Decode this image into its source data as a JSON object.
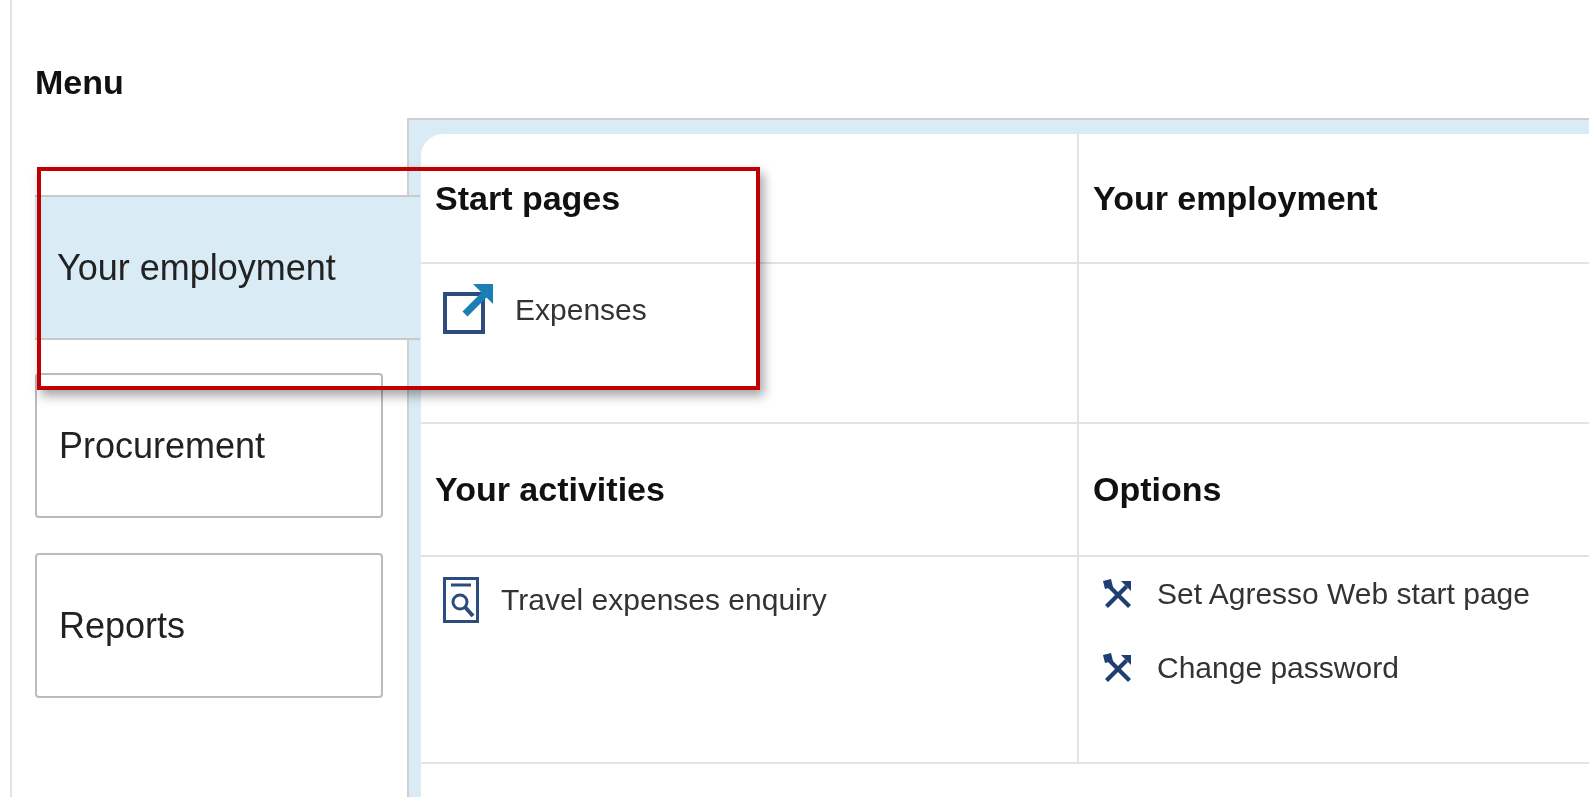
{
  "title": "Menu",
  "sidebar": {
    "items": [
      {
        "label": "Your employment",
        "selected": true
      },
      {
        "label": "Procurement",
        "selected": false
      },
      {
        "label": "Reports",
        "selected": false
      }
    ]
  },
  "panel": {
    "sections": [
      {
        "heading": "Start pages",
        "items": [
          {
            "label": "Expenses",
            "kind": "external"
          }
        ]
      },
      {
        "heading": "Your employment"
      },
      {
        "heading": "Your activities",
        "items": [
          {
            "label": "Travel expenses enquiry",
            "kind": "enquiry"
          }
        ]
      },
      {
        "heading": "Options",
        "items": [
          {
            "label": "Set Agresso Web start page",
            "kind": "tool"
          },
          {
            "label": "Change password",
            "kind": "tool"
          }
        ]
      }
    ]
  }
}
